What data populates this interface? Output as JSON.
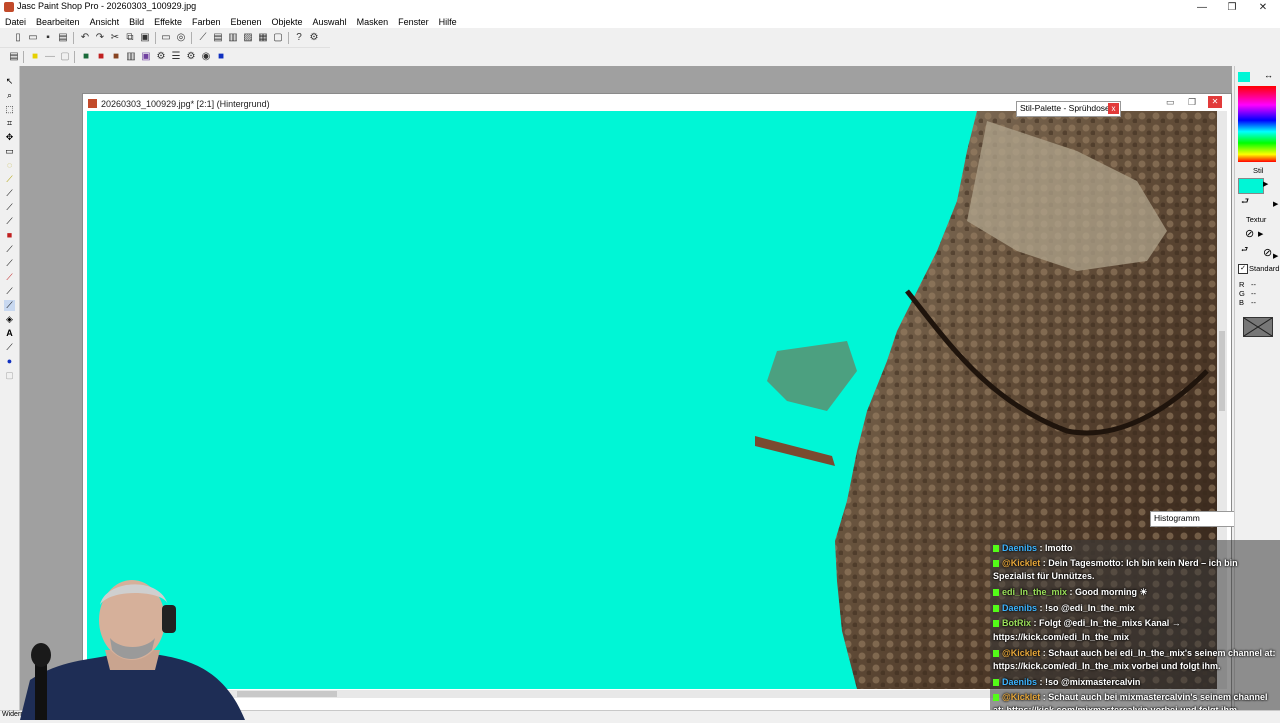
{
  "window": {
    "title": "Jasc Paint Shop Pro - 20260303_100929.jpg",
    "minimize": "—",
    "maximize": "❐",
    "close": "✕"
  },
  "menu": [
    "Datei",
    "Bearbeiten",
    "Ansicht",
    "Bild",
    "Effekte",
    "Farben",
    "Ebenen",
    "Objekte",
    "Auswahl",
    "Masken",
    "Fenster",
    "Hilfe"
  ],
  "document": {
    "title": "20260303_100929.jpg* [2:1] (Hintergrund)",
    "canvas_color": "#00f6d6"
  },
  "palettes": {
    "style_palette_title": "Stil-Palette - Sprühdose",
    "histogram_title": "Histogramm",
    "close": "x"
  },
  "right_panel": {
    "stil_label": "Stil",
    "textur_label": "Textur",
    "standard_label": "Standard",
    "r_label": "R",
    "g_label": "G",
    "b_label": "B",
    "r_value": "--",
    "g_value": "--",
    "b_value": "--",
    "foreground_color": "#00f6d6"
  },
  "chat": [
    {
      "user": "Daenibs",
      "user_color": "blue",
      "text": " : lmotto"
    },
    {
      "user": "@Kicklet",
      "user_color": "gold",
      "text": " : Dein Tagesmotto: Ich bin kein Nerd – ich bin",
      "cont": "Spezialist für Unnützes."
    },
    {
      "user": "edi_In_the_mix",
      "user_color": "green",
      "text": " : Good morning ☀"
    },
    {
      "user": "Daenibs",
      "user_color": "blue",
      "text": " : !so @edi_In_the_mix"
    },
    {
      "user": "BotRix",
      "user_color": "green",
      "text": " : Folgt @edi_In_the_mixs Kanal →",
      "cont": "https://kick.com/edi_In_the_mix"
    },
    {
      "user": "@Kicklet",
      "user_color": "gold",
      "text": " : Schaut auch bei edi_In_the_mix's seinem channel at:",
      "cont": "https://kick.com/edi_In_the_mix vorbei und folgt ihm."
    },
    {
      "user": "Daenibs",
      "user_color": "blue",
      "text": " : !so @mixmastercalvin"
    },
    {
      "user": "@Kicklet",
      "user_color": "gold",
      "text": " : Schaut auch bei mixmastercalvin's seinem channel",
      "cont": "at: https://kick.com/mixmastercalvin vorbei und folgt ihm."
    }
  ],
  "status": {
    "text": "Widerr"
  }
}
